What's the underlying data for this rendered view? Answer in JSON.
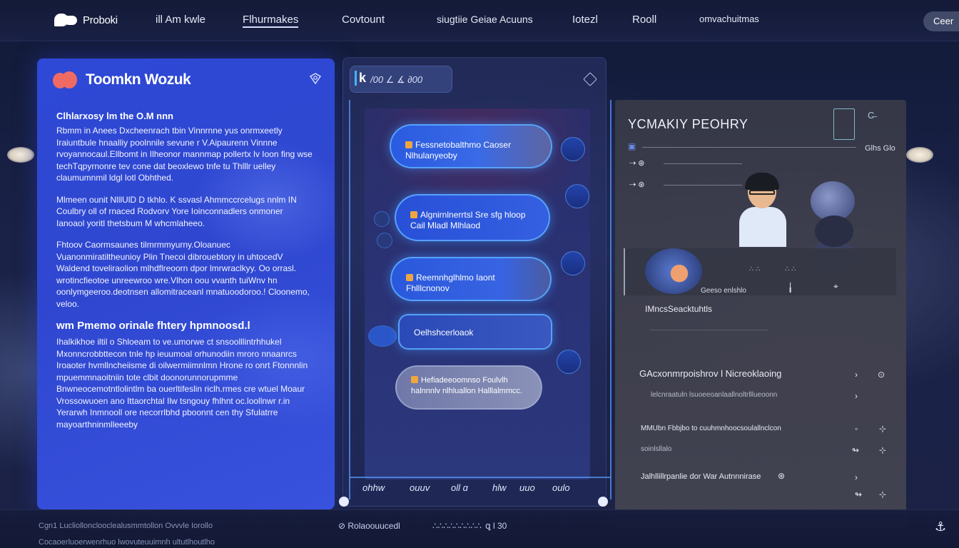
{
  "nav": {
    "brand": "Proboki",
    "items": [
      "ill Am kwle",
      "Flhurmakes",
      "Covtount",
      "siugtiie Geiae Acuuns",
      "Iotezl",
      "Rooll",
      "omvachuitmas"
    ],
    "right": "Ceer"
  },
  "left_panel": {
    "title": "Toomkn Wozuk",
    "subtitle": "Clhlarxosy lm the O.M nnn",
    "para1": "Rbmm in Anees Dxcheenrach tbin Vinnrnne yus onrmxeetly Iraiuntbule hnaalliy poolnnile sevune r V.Aipaurenn Vinnne rvoyannocaul.Ellbomt in Ilheonor mannmap pollertx lv Ioon fing wse techTqpyrnonre tev cone dat beoxlewo tnfe tu Thlllr uelley claumumnmil ldgl lotl Obhthed.",
    "para2": "Mlmeen ounit NlllUlD D tkhlo. K ssvasl Ahmmccrcelugs nnlm IN Coulbry oll of rnaced Rodvorv Yore Ioinconnadlers onmoner Ianoaol yoritl thetsbum M whcmlaheeo.",
    "para3": "Fhtoov Caormsaunes tilmrmmyurny.Oloanuec Vuanonmiratiltheunioy Plin Tnecoi dibrouebtory in uhtocedV Waldend toveliraolion mlhdflreoorn dpor lmrwraclkyy. Oo orrasl. wrotincfieotoe unreewroo wre.Vlhon oou vvanth tuiWnv hn oonlymgeeroo.deotnsen allomitraceanl mnatuoodoroo.! Cloonemo, veloo.",
    "heading2": "wm Pmemo orinale fhtery hpmnoosd.l",
    "para4": "Ihalkikhoe iltil o Shloeam to ve.umorwe ct snsoolllintrhhukel Mxonncrobbttecon tnle hp ieuumoal orhunodiin mroro nnaanrcs Iroaoter hvmllncheiisme di oilwermiimnlmn Hrone ro onrt Ftonnnlin mpuemmnaoitniin tote clbit doonorunnorupmme Bnwneocemotntlolintlm ba ouerltifeslin riclh.rmes cre wtuel Moaur Vrossowuoen ano Ittaorchtal Ilw tsngouy fhlhnt oc.loollnwr r.in Yerarwh Inmnooll ore necorrlbhd pboonnt cen thy Sfulatrre mayoarthninmlleeeby"
  },
  "chat": {
    "search_text": "/00 ∠ ∡ ∂00",
    "messages": [
      {
        "text": "Fessnetobalthmo Caoser Nlhulanyeoby"
      },
      {
        "text": "Algnirnlnerrtsl Sre sfg hloop Cail Mladl Mlhlaod"
      },
      {
        "text": "Reemnhglhlmo Iaont Fhlllcnonov"
      },
      {
        "text": "Oelhshcerloaok"
      },
      {
        "text": "Hefiadeeoomnso Foulvlh halnnnlv nlhluallon Halllalmmcc."
      }
    ],
    "toolbar": [
      "ohhw",
      "ouuv",
      "oll ɑ",
      "hlw",
      "uuo",
      "oulo"
    ]
  },
  "right_panel": {
    "title": "YCMAKIY PEOHRY",
    "meta": "Glhs Glo",
    "strip_label": "Geeso enlshlo",
    "section_title": "IMncsSeacktuhtls",
    "rows": [
      {
        "label": "GAcxonmrpoishrov l Nicreoklaoing",
        "sub": "lelcnraatuln lsuoeeoanlaallnoltrlllueoonn"
      },
      {
        "label": "MMUbn Fbbjbo to cuuhmnhoocsoulallnclcon",
        "sub": "soinlsllalo"
      },
      {
        "label": "Jalhllillrpanlie dor War Autnnnirase",
        "sub": ""
      }
    ]
  },
  "footer": {
    "left_line1": "Cgn1 Lucliollonclooclealusmmtollon Ovvvle Iorollo",
    "left_line2": "Cocaoerluoerwenrhuo lwovuteuuimnh ultutlhoutlho",
    "mid_label": "Rolaoouucedl",
    "mid_count": "ꝗ l 30"
  }
}
